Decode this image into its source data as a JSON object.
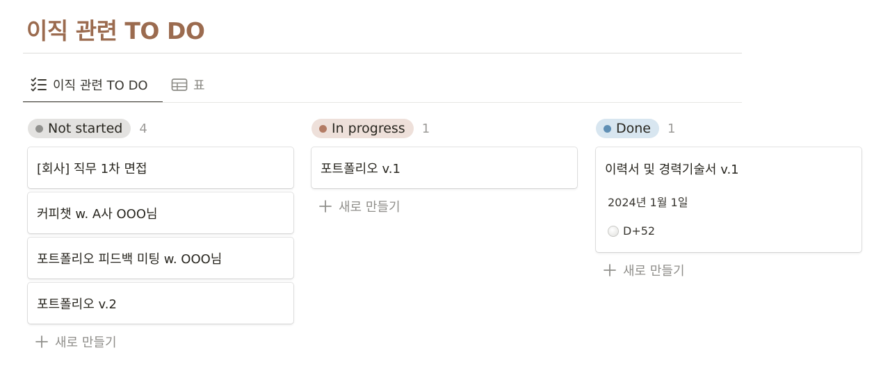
{
  "page": {
    "title": "이직 관련 TO DO"
  },
  "tabs": [
    {
      "label": "이직 관련 TO DO",
      "icon": "checklist-icon",
      "active": true
    },
    {
      "label": "표",
      "icon": "table-icon",
      "active": false
    }
  ],
  "columns": [
    {
      "status": "Not started",
      "count": "4",
      "pill_bg": "#e3e2e0",
      "dot_color": "#91918e",
      "cards": [
        {
          "title": "[회사] 직무 1차 면접"
        },
        {
          "title": "커피챗 w. A사 OOO님"
        },
        {
          "title": "포트폴리오 피드백 미팅 w. OOO님"
        },
        {
          "title": "포트폴리오 v.2"
        }
      ],
      "new_label": "새로 만들기"
    },
    {
      "status": "In progress",
      "count": "1",
      "pill_bg": "#eee0da",
      "dot_color": "#b37b64",
      "cards": [
        {
          "title": "포트폴리오 v.1"
        }
      ],
      "new_label": "새로 만들기"
    },
    {
      "status": "Done",
      "count": "1",
      "pill_bg": "#d8e6f0",
      "dot_color": "#5f8fb4",
      "cards": [
        {
          "title": "이력서 및 경력기술서 v.1",
          "date": "2024년 1월 1일",
          "dday": "D+52"
        }
      ],
      "new_label": "새로 만들기"
    }
  ],
  "colors": {
    "title": "#9b6b4f",
    "text": "#37352f",
    "muted": "#8f8e8a"
  }
}
